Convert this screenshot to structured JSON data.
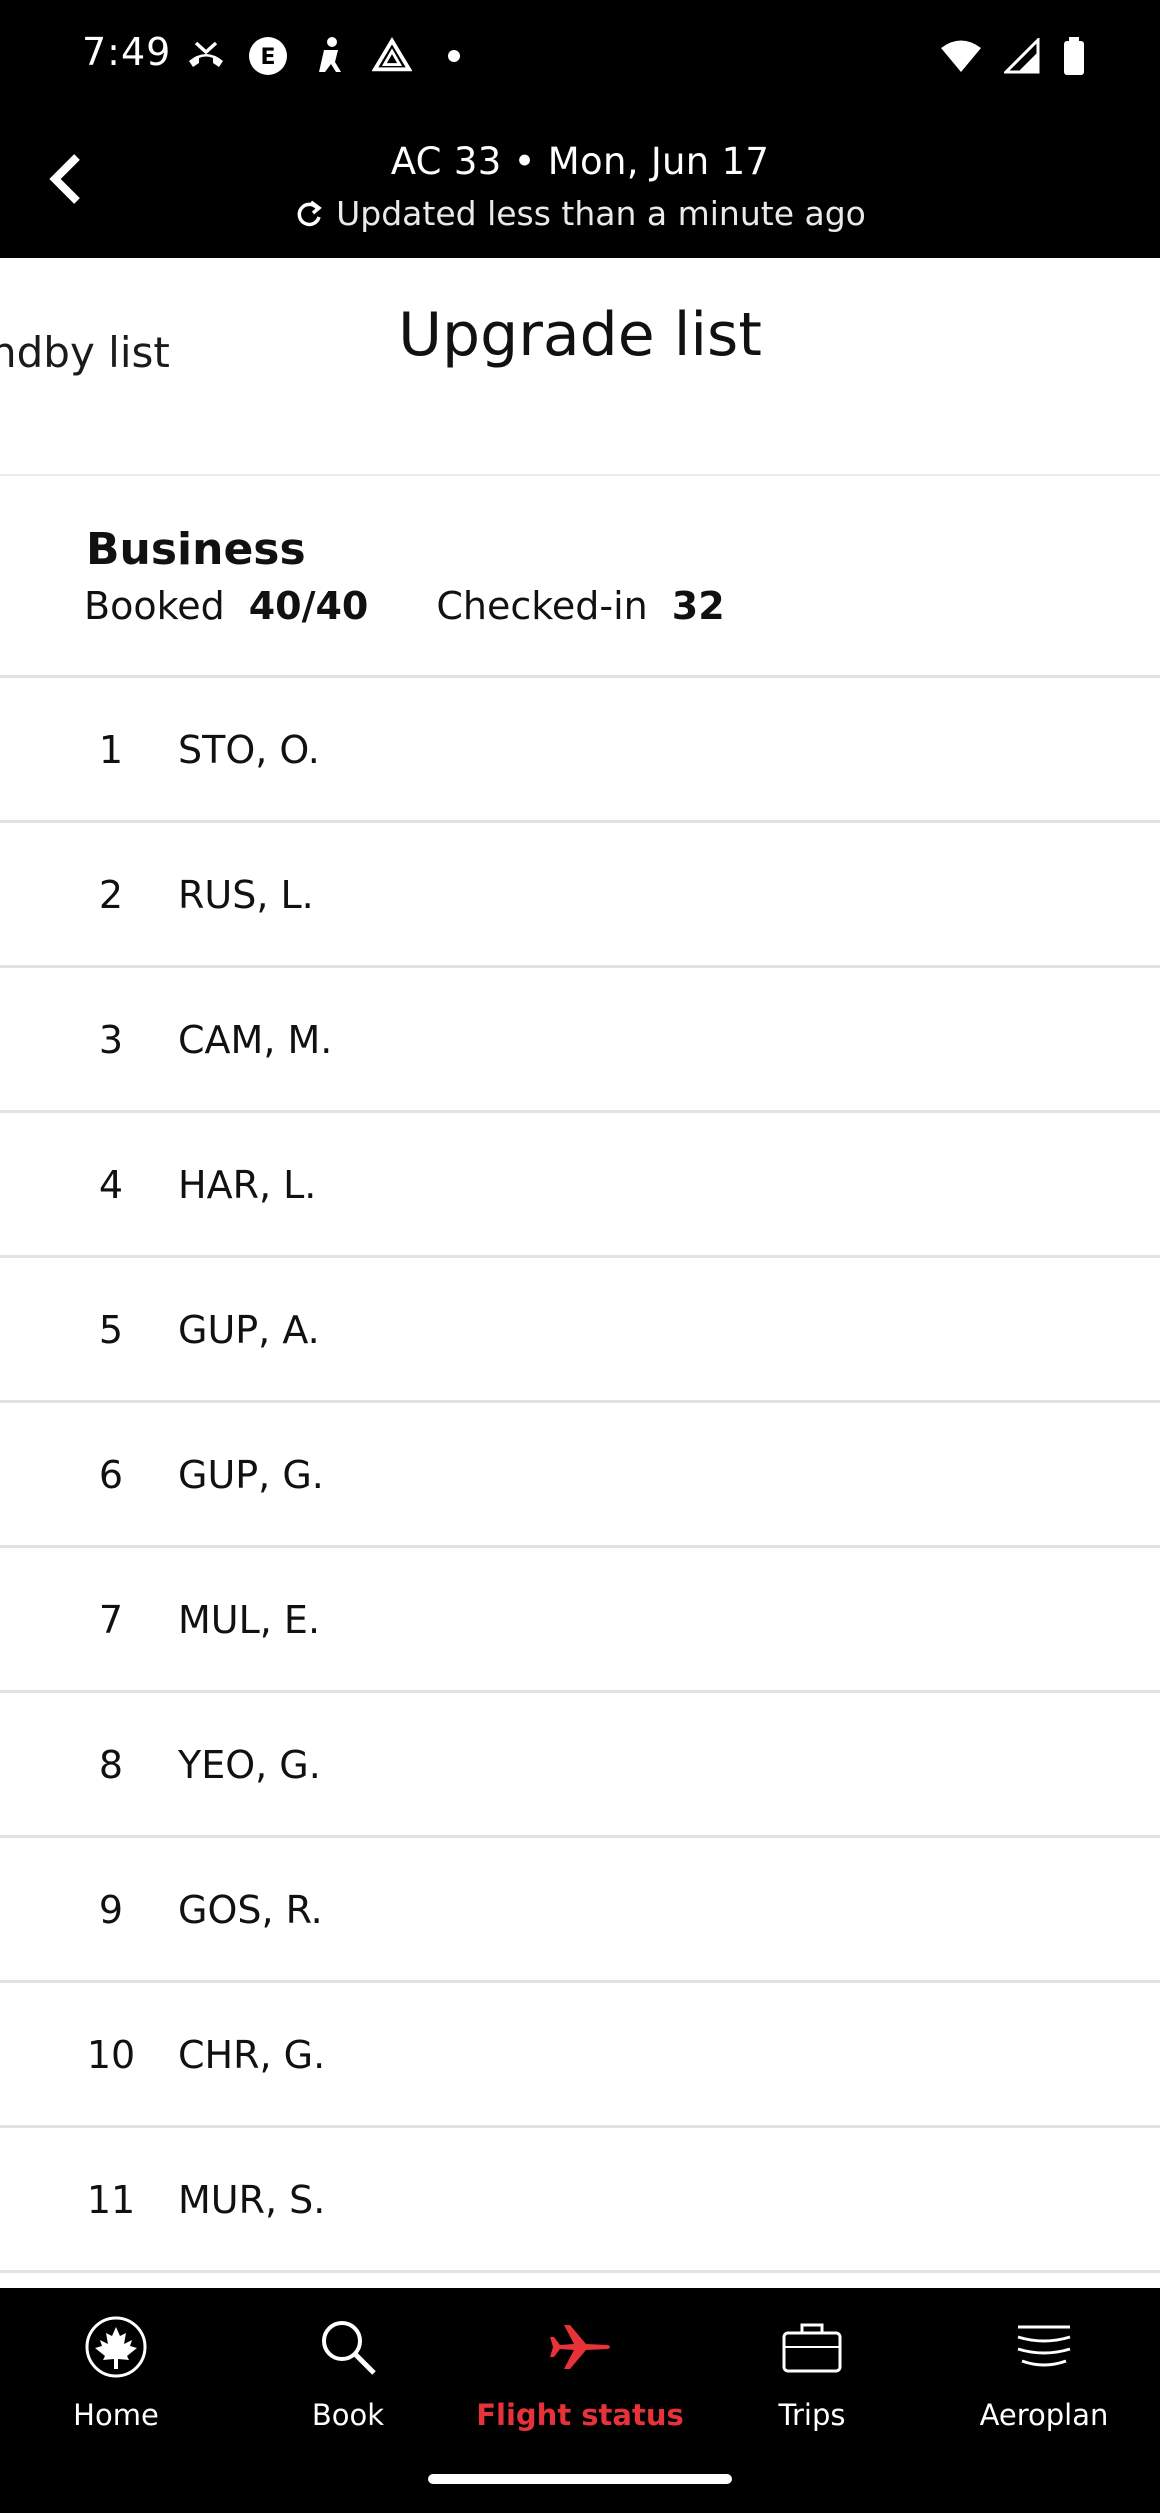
{
  "status_bar": {
    "time": "7:49",
    "left_icons": [
      "missed-call-icon",
      "e-badge-icon",
      "accessibility-icon",
      "drive-icon",
      "dot-icon"
    ],
    "right_icons": [
      "wifi-icon",
      "signal-icon",
      "battery-icon"
    ]
  },
  "header": {
    "title": "AC 33 • Mon, Jun 17",
    "subtitle": "Updated less than a minute ago"
  },
  "tabs": {
    "standby": "ndby list",
    "upgrade": "Upgrade list"
  },
  "cabin": {
    "name": "Business",
    "booked_label": "Booked",
    "booked_value": "40/40",
    "checked_label": "Checked-in",
    "checked_value": "32"
  },
  "list": [
    {
      "rank": "1",
      "name": "STO, O."
    },
    {
      "rank": "2",
      "name": "RUS, L."
    },
    {
      "rank": "3",
      "name": "CAM, M."
    },
    {
      "rank": "4",
      "name": "HAR, L."
    },
    {
      "rank": "5",
      "name": "GUP, A."
    },
    {
      "rank": "6",
      "name": "GUP, G."
    },
    {
      "rank": "7",
      "name": "MUL, E."
    },
    {
      "rank": "8",
      "name": "YEO, G."
    },
    {
      "rank": "9",
      "name": "GOS, R."
    },
    {
      "rank": "10",
      "name": "CHR, G."
    },
    {
      "rank": "11",
      "name": "MUR, S."
    }
  ],
  "nav": {
    "home": "Home",
    "book": "Book",
    "flight_status": "Flight status",
    "trips": "Trips",
    "aeroplan": "Aeroplan"
  },
  "colors": {
    "active": "#e8323a",
    "bar": "#000000"
  }
}
